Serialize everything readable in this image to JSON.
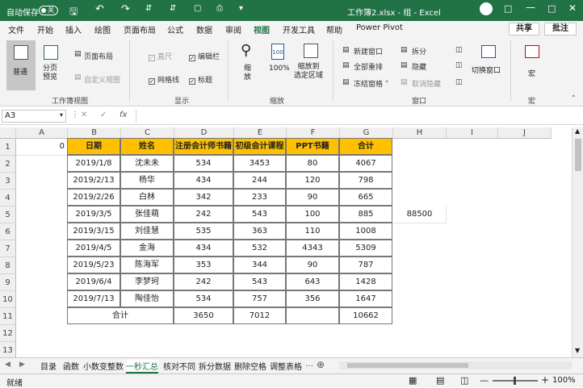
{
  "titlebar": {
    "autosave_label": "自动保存",
    "autosave_state": "关",
    "file_title": "工作簿2.xlsx - 组 - Excel"
  },
  "tabs": [
    "文件",
    "开始",
    "插入",
    "绘图",
    "页面布局",
    "公式",
    "数据",
    "审阅",
    "视图",
    "开发工具",
    "帮助",
    "Power Pivot"
  ],
  "active_tab": "视图",
  "share_label": "共享",
  "comment_label": "批注",
  "ribbon": {
    "normal": "普通",
    "page_break": "分页\n预览",
    "page_layout": "页面布局",
    "custom_view": "自定义视图",
    "ruler": "直尺",
    "formula_bar": "编辑栏",
    "gridlines": "网格线",
    "headings": "标题",
    "zoom": "缩\n放",
    "zoom100": "100%",
    "zoom_sel": "缩放到\n选定区域",
    "new_window": "新建窗口",
    "arrange_all": "全部重排",
    "freeze": "冻结窗格",
    "split": "拆分",
    "hide": "隐藏",
    "unhide": "取消隐藏",
    "switch_window": "切换窗口",
    "macro": "宏",
    "grp_workbook_view": "工作簿视图",
    "grp_show": "显示",
    "grp_zoom": "缩放",
    "grp_window": "窗口",
    "grp_macro": "宏"
  },
  "formula_bar": {
    "name_box": "A3",
    "fx": "fx",
    "formula": ""
  },
  "columns": [
    "A",
    "B",
    "C",
    "D",
    "E",
    "F",
    "G",
    "H",
    "I",
    "J"
  ],
  "rows": [
    "1",
    "2",
    "3",
    "4",
    "5",
    "6",
    "7",
    "8",
    "9",
    "10",
    "11",
    "12",
    "13"
  ],
  "cells": {
    "a1": "0",
    "h5": "88500",
    "header": [
      "日期",
      "姓名",
      "注册会计师书籍",
      "初级会计课程",
      "PPT书籍",
      "合计"
    ],
    "data": [
      [
        "2019/1/8",
        "沈未未",
        "534",
        "3453",
        "80",
        "4067"
      ],
      [
        "2019/2/13",
        "杨华",
        "434",
        "244",
        "120",
        "798"
      ],
      [
        "2019/2/26",
        "白林",
        "342",
        "233",
        "90",
        "665"
      ],
      [
        "2019/3/5",
        "张佳萌",
        "242",
        "543",
        "100",
        "885"
      ],
      [
        "2019/3/15",
        "刘佳慧",
        "535",
        "363",
        "110",
        "1008"
      ],
      [
        "2019/4/5",
        "金海",
        "434",
        "532",
        "4343",
        "5309"
      ],
      [
        "2019/5/23",
        "陈海军",
        "353",
        "344",
        "90",
        "787"
      ],
      [
        "2019/6/4",
        "李梦珂",
        "242",
        "543",
        "643",
        "1428"
      ],
      [
        "2019/7/13",
        "陶佳怡",
        "534",
        "757",
        "356",
        "1647"
      ]
    ],
    "total": [
      "合计",
      "3650",
      "7012",
      "",
      "10662"
    ]
  },
  "sheets": [
    "目录",
    "函数",
    "小数变整数",
    "一秒汇总",
    "核对不同",
    "拆分数据",
    "删除空格",
    "调整表格"
  ],
  "active_sheet": "一秒汇总",
  "status": {
    "ready": "就绪",
    "zoom": "100%"
  },
  "colors": {
    "excel_green": "#217346",
    "header_fill": "#ffc000"
  }
}
